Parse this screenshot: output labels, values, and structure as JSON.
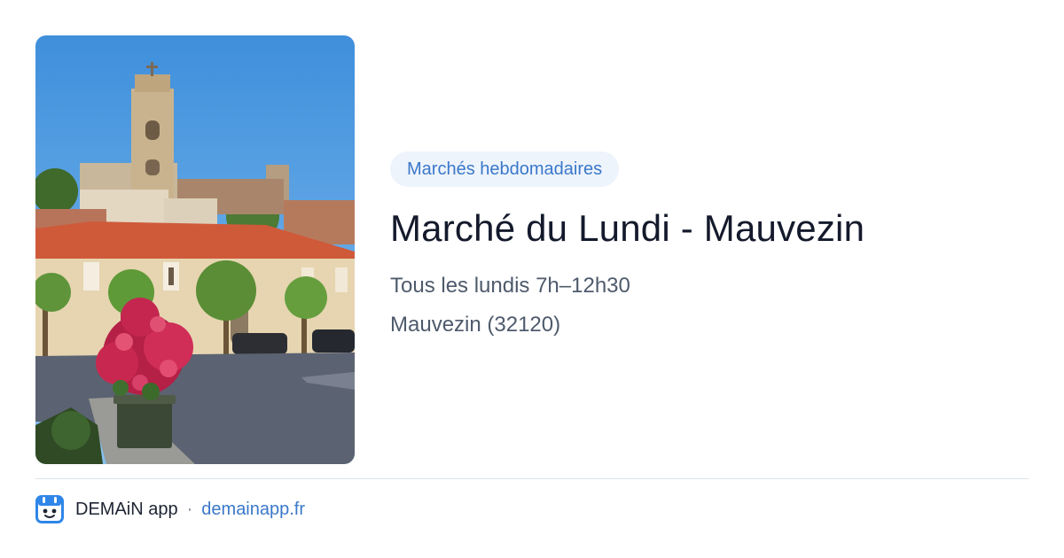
{
  "card": {
    "category_badge": "Marchés hebdomadaires",
    "title": "Marché du Lundi - Mauvezin",
    "schedule": "Tous les lundis 7h–12h30",
    "location": "Mauvezin (32120)"
  },
  "footer": {
    "brand_name": "DEMAiN app",
    "separator": "·",
    "website": "demainapp.fr"
  },
  "colors": {
    "accent": "#3a78c9",
    "badge_background": "#eef4fc",
    "title_text": "#141a2c",
    "secondary_text": "#4e5a6c"
  }
}
